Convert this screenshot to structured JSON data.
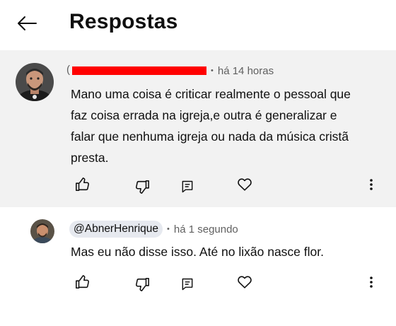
{
  "header": {
    "title": "Respostas",
    "back_icon": "arrow-left-icon"
  },
  "comments": [
    {
      "author_redacted": true,
      "author_prefix": "(",
      "time": "há 14 horas",
      "text": "Mano uma coisa é criticar realmente o pessoal que faz coisa errada na igreja,e outra é generalizar e falar que nenhuma igreja ou nada da música cristã presta.",
      "lines": [
        "Mano uma coisa é criticar realmente o pessoal que",
        "faz coisa errada na igreja,e outra é generalizar e",
        "falar que nenhuma igreja ou nada da música cristã",
        "presta."
      ],
      "actions": [
        "thumbs-up-icon",
        "thumbs-down-icon",
        "reply-icon",
        "heart-icon",
        "more-vert-icon"
      ]
    },
    {
      "author": "@AbnerHenrique",
      "time": "há 1 segundo",
      "text": "Mas eu não disse isso. Até no lixão nasce flor.",
      "actions": [
        "thumbs-up-icon",
        "thumbs-down-icon",
        "reply-icon",
        "heart-icon",
        "more-vert-icon"
      ]
    }
  ],
  "colors": {
    "background": "#ffffff",
    "highlight_bg": "#f2f2f2",
    "redaction": "#ff0000",
    "chip_bg": "#e6e9ef",
    "muted_text": "#606060"
  }
}
